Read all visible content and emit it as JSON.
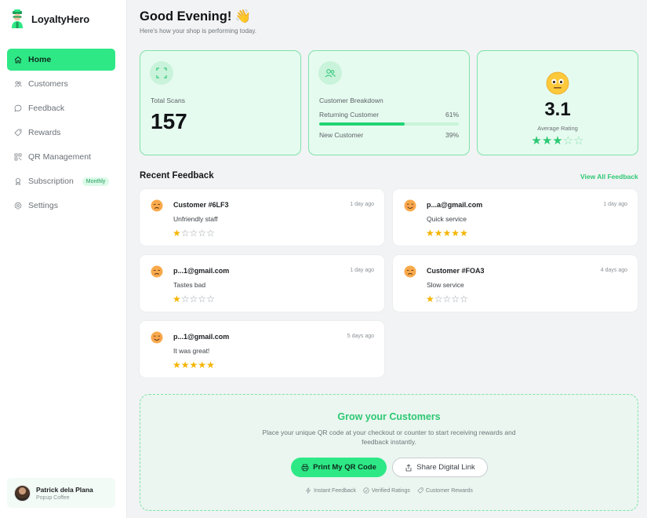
{
  "brand": {
    "name": "LoyaltyHero"
  },
  "nav": [
    {
      "label": "Home",
      "icon": "home-icon",
      "active": true
    },
    {
      "label": "Customers",
      "icon": "users-icon"
    },
    {
      "label": "Feedback",
      "icon": "chat-bubble-icon"
    },
    {
      "label": "Rewards",
      "icon": "tag-icon"
    },
    {
      "label": "QR Management",
      "icon": "qr-code-icon"
    },
    {
      "label": "Subscription",
      "icon": "badge-icon",
      "badge": "Monthly"
    },
    {
      "label": "Settings",
      "icon": "gear-icon"
    }
  ],
  "user": {
    "name": "Patrick dela Plana",
    "shop": "Popup Coffee"
  },
  "header": {
    "greeting": "Good Evening! 👋",
    "subtitle": "Here's how your shop is performing today."
  },
  "stats": {
    "scans": {
      "label": "Total Scans",
      "value": "157"
    },
    "breakdown": {
      "label": "Customer Breakdown",
      "returning_label": "Returning Customer",
      "returning_pct": "61%",
      "returning_fraction": 0.61,
      "new_label": "New Customer",
      "new_pct": "39%"
    },
    "rating": {
      "value": "3.1",
      "label": "Average Rating",
      "stars": 3
    }
  },
  "recent": {
    "title": "Recent Feedback",
    "view_all": "View All Feedback"
  },
  "feedback": [
    {
      "name": "Customer #6LF3",
      "time": "1 day ago",
      "message": "Unfriendly staff",
      "stars": 1,
      "mood": "sad"
    },
    {
      "name": "p...a@gmail.com",
      "time": "1 day ago",
      "message": "Quick service",
      "stars": 5,
      "mood": "happy"
    },
    {
      "name": "p...1@gmail.com",
      "time": "1 day ago",
      "message": "Tastes bad",
      "stars": 1,
      "mood": "sad"
    },
    {
      "name": "Customer #FOA3",
      "time": "4 days ago",
      "message": "Slow service",
      "stars": 1,
      "mood": "sad"
    },
    {
      "name": "p...1@gmail.com",
      "time": "5 days ago",
      "message": "It was great!",
      "stars": 5,
      "mood": "happy"
    }
  ],
  "grow": {
    "title": "Grow your Customers",
    "description": "Place your unique QR code at your checkout or counter to start receiving rewards and feedback instantly.",
    "print_button": "Print My QR Code",
    "share_button": "Share Digital Link",
    "features": [
      "Instant Feedback",
      "Verified Ratings",
      "Customer Rewards"
    ]
  },
  "colors": {
    "accent": "#2ee886",
    "accent_text": "#2ec874",
    "star": "#f5b400"
  }
}
